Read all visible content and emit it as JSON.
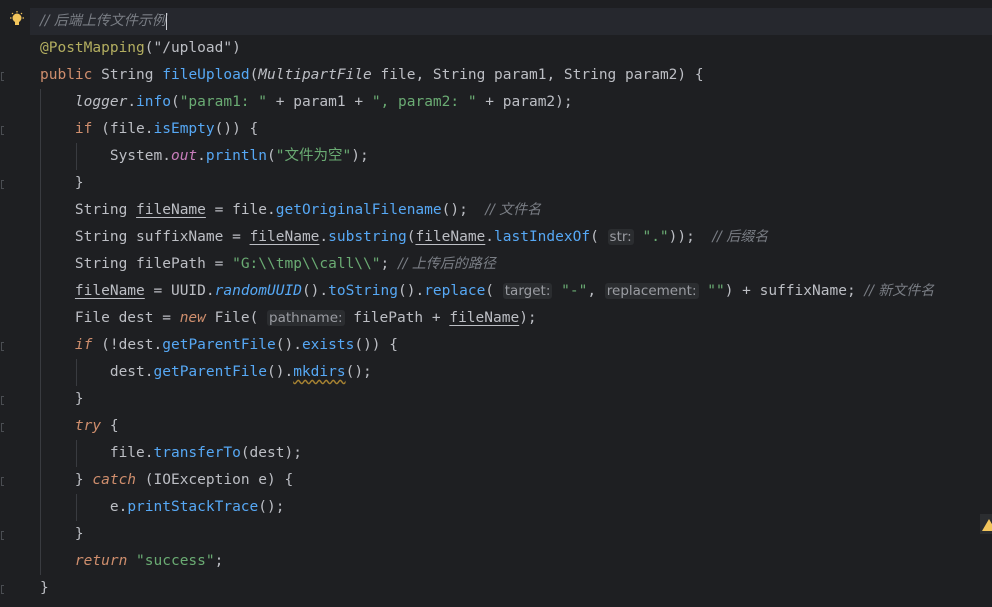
{
  "code": {
    "comment_title": "// 后端上传文件示例",
    "annotation": "@PostMapping",
    "annotation_arg": "(\"/upload\")",
    "kw_public": "public",
    "type_string": "String",
    "method_name": "fileUpload",
    "type_multipart": "MultipartFile",
    "param_file": "file",
    "param1": "param1",
    "param2": "param2",
    "logger": "logger",
    "info": "info",
    "str_param1": "\"param1: \"",
    "str_param2": "\", param2: \"",
    "kw_if": "if",
    "is_empty": "isEmpty",
    "system": "System",
    "out": "out",
    "println": "println",
    "str_empty": "\"文件为空\"",
    "var_filename": "fileName",
    "get_original": "getOriginalFilename",
    "comment_filename": "// 文件名",
    "var_suffix": "suffixName",
    "substring": "substring",
    "last_index_of": "lastIndexOf",
    "hint_str": "str:",
    "str_dot": "\".\"",
    "comment_suffix": "// 后缀名",
    "var_filepath": "filePath",
    "str_path": "\"G:\\\\tmp\\\\call\\\\\"",
    "comment_path": "// 上传后的路径",
    "uuid": "UUID",
    "random_uuid": "randomUUID",
    "to_string": "toString",
    "replace": "replace",
    "hint_target": "target:",
    "str_dash": "\"-\"",
    "hint_replacement": "replacement:",
    "str_blank": "\"\"",
    "comment_newname": "// 新文件名",
    "type_file": "File",
    "var_dest": "dest",
    "kw_new": "new",
    "hint_pathname": "pathname:",
    "get_parent": "getParentFile",
    "exists": "exists",
    "mkdirs": "mkdirs",
    "kw_try": "try",
    "transfer_to": "transferTo",
    "kw_catch": "catch",
    "io_exception": "IOException",
    "var_e": "e",
    "print_stack": "printStackTrace",
    "kw_return": "return",
    "str_success": "\"success\""
  },
  "colors": {
    "background": "#1e1f22",
    "keyword": "#cf8e6d",
    "string": "#6aab73",
    "annotation": "#b3ae60",
    "method_call": "#56a8f5",
    "comment": "#7a7e85",
    "warning": "#f2c55c"
  },
  "icons": {
    "gutter": "lightbulb-icon",
    "status": "warning-icon"
  }
}
